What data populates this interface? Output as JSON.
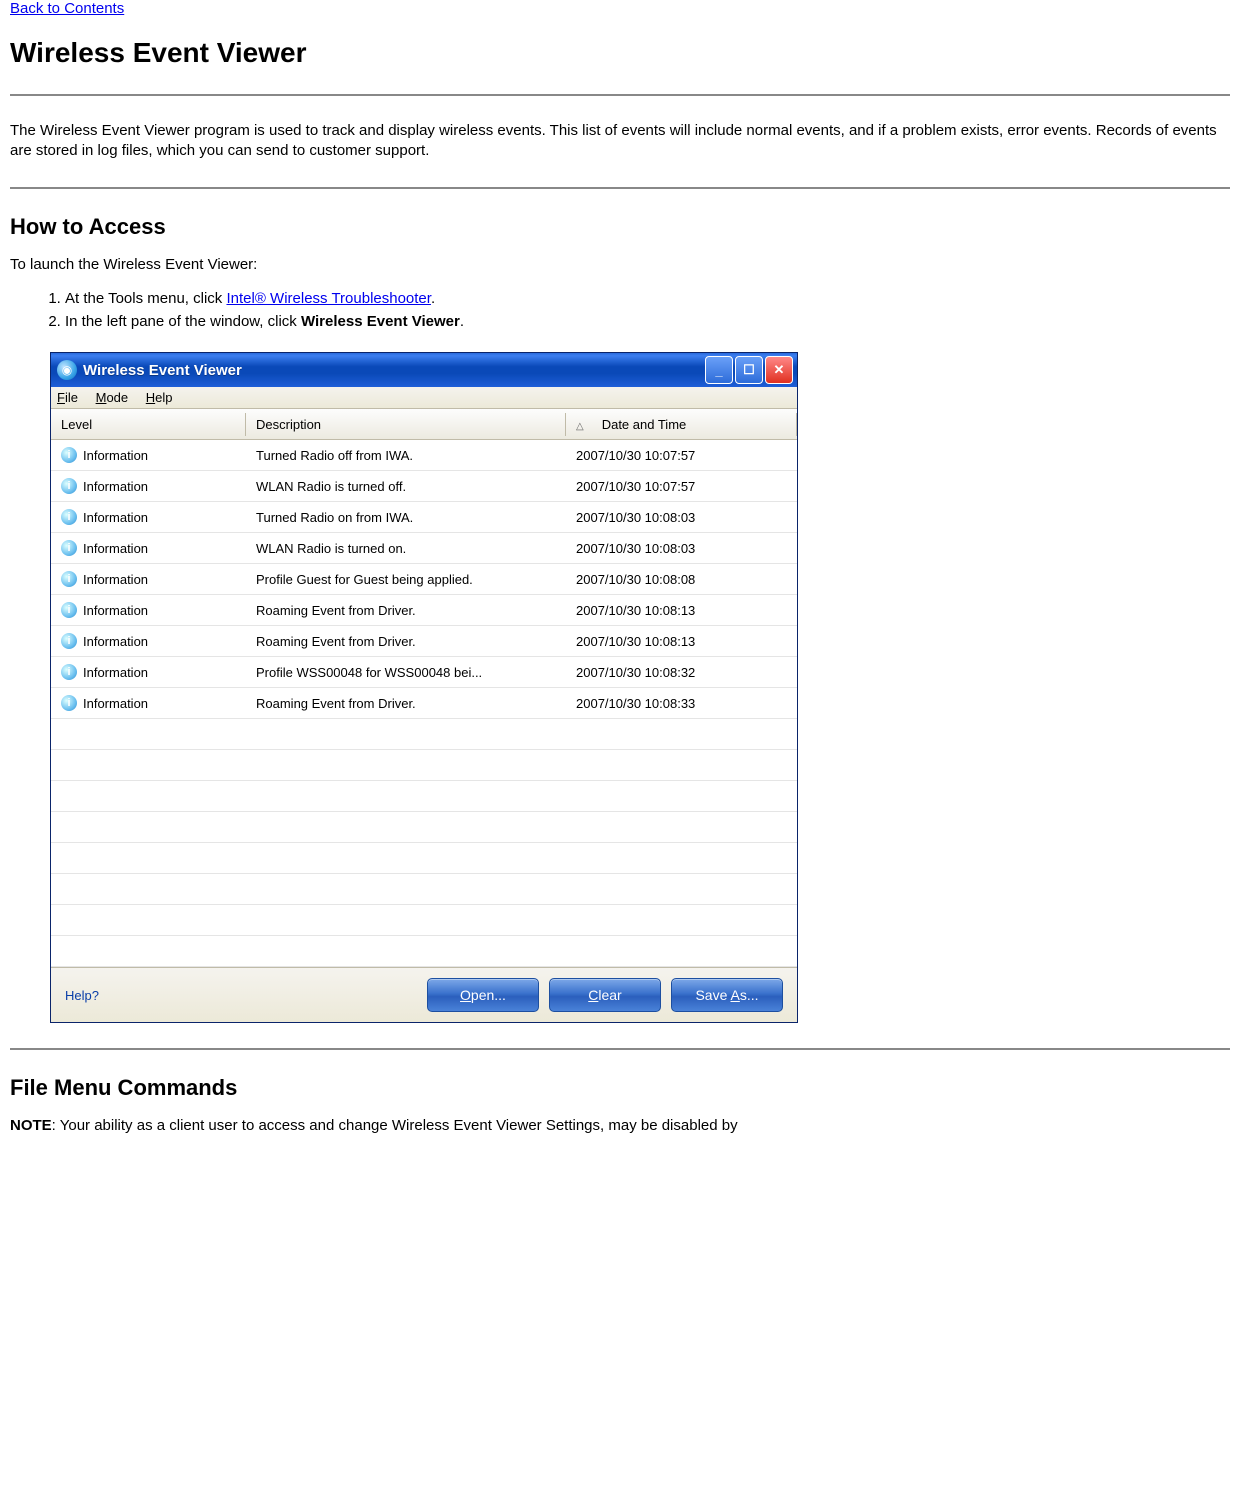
{
  "nav": {
    "back_link": "Back to Contents"
  },
  "title": "Wireless Event Viewer",
  "intro": "The Wireless Event Viewer program is used to track and display wireless events. This list of events will include normal events, and if a problem exists, error events. Records of events are stored in log files, which you can send to customer support.",
  "howto": {
    "heading": "How to Access",
    "lead": "To launch the Wireless Event Viewer:",
    "step1_pre": "At the Tools menu, click ",
    "step1_link": "Intel® Wireless Troubleshooter",
    "step1_post": ".",
    "step2_pre": "In the left pane of the window, click ",
    "step2_bold": "Wireless Event Viewer",
    "step2_post": "."
  },
  "window": {
    "title": "Wireless Event Viewer",
    "menus": {
      "file": "File",
      "mode": "Mode",
      "help": "Help"
    },
    "columns": {
      "level": "Level",
      "description": "Description",
      "date": "Date and Time"
    },
    "rows": [
      {
        "level": "Information",
        "desc": "Turned Radio off from IWA.",
        "date": "2007/10/30 10:07:57"
      },
      {
        "level": "Information",
        "desc": "WLAN Radio is turned off.",
        "date": "2007/10/30 10:07:57"
      },
      {
        "level": "Information",
        "desc": "Turned Radio on from IWA.",
        "date": "2007/10/30 10:08:03"
      },
      {
        "level": "Information",
        "desc": "WLAN Radio is turned on.",
        "date": "2007/10/30 10:08:03"
      },
      {
        "level": "Information",
        "desc": "Profile Guest for Guest being applied.",
        "date": "2007/10/30 10:08:08"
      },
      {
        "level": "Information",
        "desc": "Roaming Event from Driver.",
        "date": "2007/10/30 10:08:13"
      },
      {
        "level": "Information",
        "desc": "Roaming Event from Driver.",
        "date": "2007/10/30 10:08:13"
      },
      {
        "level": "Information",
        "desc": "Profile WSS00048 for WSS00048 bei...",
        "date": "2007/10/30 10:08:32"
      },
      {
        "level": "Information",
        "desc": "Roaming Event from Driver.",
        "date": "2007/10/30 10:08:33"
      }
    ],
    "empty_rows": 8,
    "footer": {
      "help": "Help?",
      "open": "Open...",
      "clear": "Clear",
      "saveas": "Save As..."
    }
  },
  "filemenu": {
    "heading": "File Menu Commands",
    "note_label": "NOTE",
    "note_text": ": Your ability as a client user to access and change Wireless Event Viewer Settings, may be disabled by"
  }
}
